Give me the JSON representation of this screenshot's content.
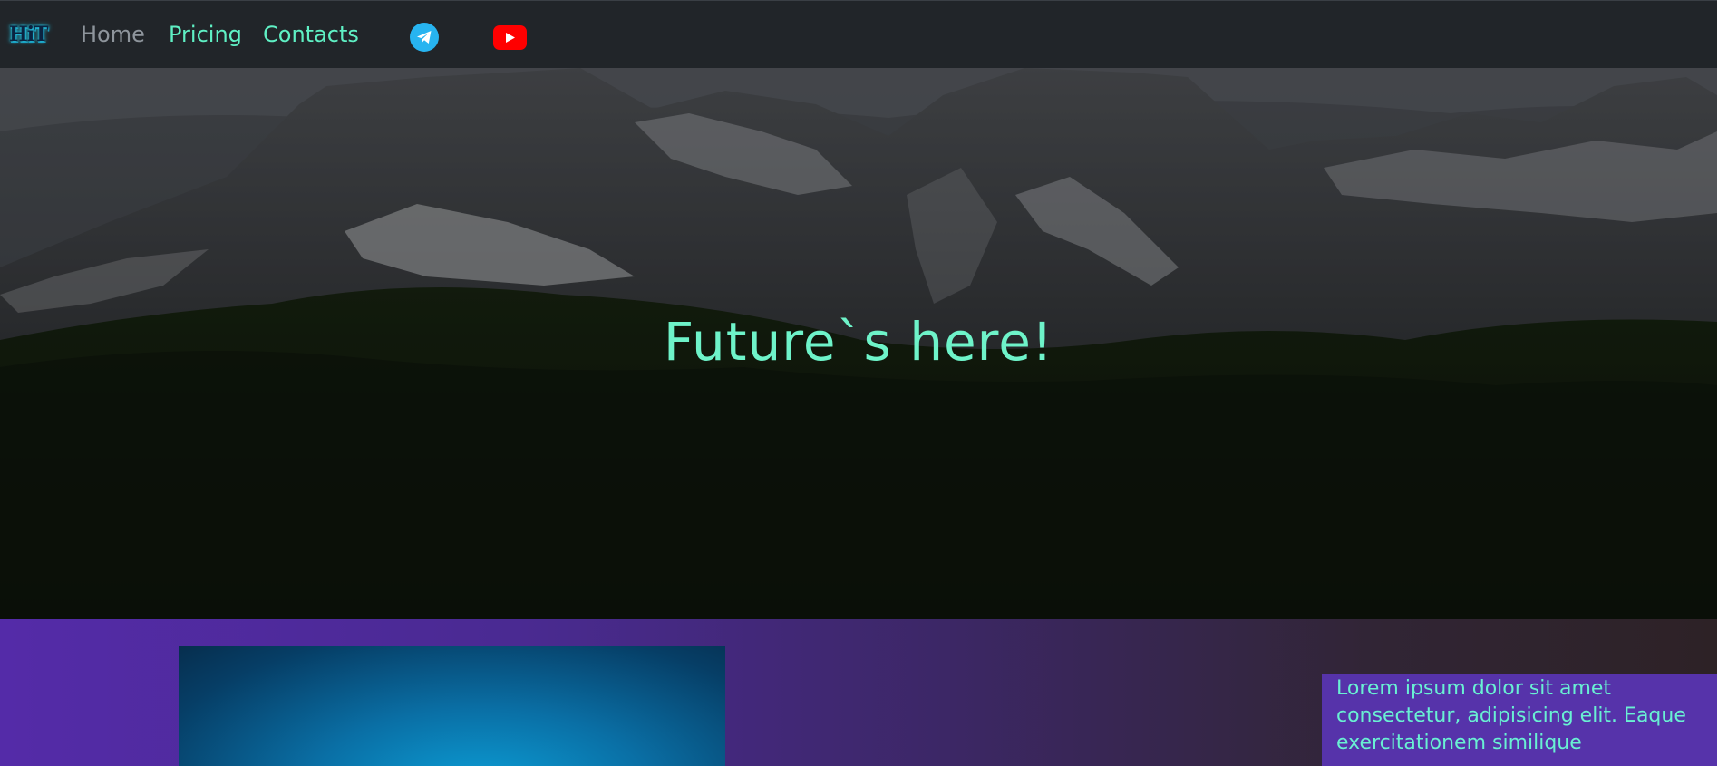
{
  "navbar": {
    "logo_text": "HiT",
    "links": [
      {
        "label": "Home"
      },
      {
        "label": "Pricing"
      },
      {
        "label": "Contacts"
      }
    ],
    "social_icons": [
      "telegram-icon",
      "youtube-icon"
    ]
  },
  "hero": {
    "title": "Future`s here!"
  },
  "feature": {
    "text": "Lorem ipsum dolor sit amet consectetur, adipisicing elit. Eaque exercitationem similique"
  },
  "colors": {
    "nav_bg": "#212529",
    "accent": "#5ff0c4",
    "muted_link": "#8e959c",
    "telegram": "#27b4f0",
    "youtube": "#ff0000",
    "purple": "#542ba8"
  }
}
